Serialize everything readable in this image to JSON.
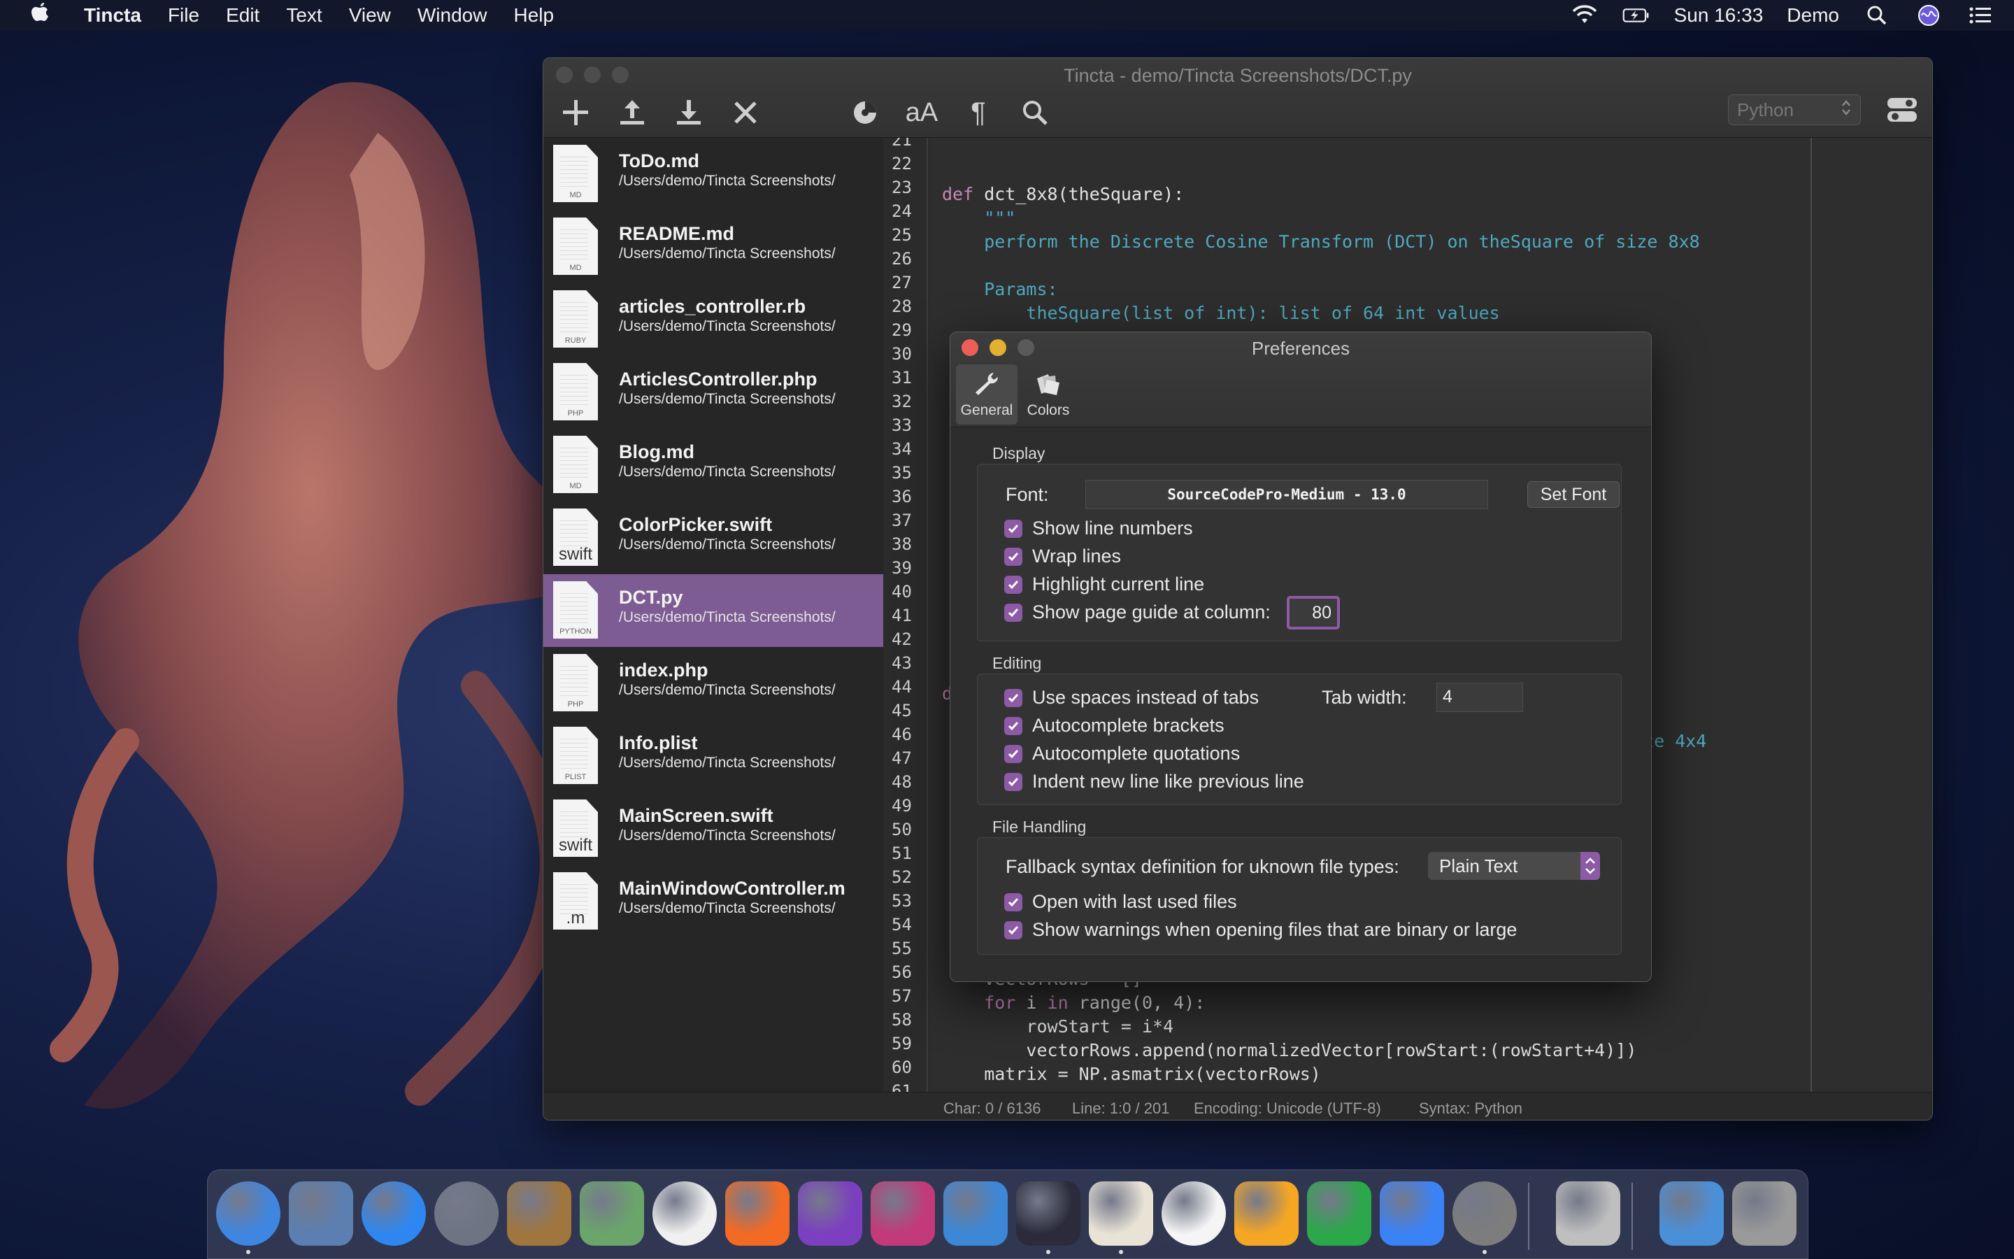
{
  "menubar": {
    "app_name": "Tincta",
    "items": [
      "File",
      "Edit",
      "Text",
      "View",
      "Window",
      "Help"
    ],
    "clock": "Sun 16:33",
    "user": "Demo",
    "icons": [
      "apple-icon",
      "wifi-icon",
      "battery-icon",
      "search-icon",
      "siri-icon",
      "notification-center-icon"
    ]
  },
  "window": {
    "title": "Tincta - demo/Tincta Screenshots/DCT.py",
    "toolbar_icons": [
      "new-icon",
      "upload-icon",
      "download-icon",
      "close-file-icon",
      "color-wheel-icon",
      "font-size-icon",
      "pilcrow-icon",
      "search-icon"
    ],
    "font_size_label": "aA",
    "pilcrow_label": "¶",
    "syntax_select": "Python"
  },
  "sidebar": {
    "files": [
      {
        "name": "ToDo.md",
        "path": "/Users/demo/Tincta Screenshots/",
        "ext": "MD",
        "selected": false
      },
      {
        "name": "README.md",
        "path": "/Users/demo/Tincta Screenshots/",
        "ext": "MD",
        "selected": false
      },
      {
        "name": "articles_controller.rb",
        "path": "/Users/demo/Tincta Screenshots/",
        "ext": "RUBY",
        "selected": false
      },
      {
        "name": "ArticlesController.php",
        "path": "/Users/demo/Tincta Screenshots/",
        "ext": "PHP",
        "selected": false
      },
      {
        "name": "Blog.md",
        "path": "/Users/demo/Tincta Screenshots/",
        "ext": "MD",
        "selected": false
      },
      {
        "name": "ColorPicker.swift",
        "path": "/Users/demo/Tincta Screenshots/",
        "ext": "swift",
        "selected": false
      },
      {
        "name": "DCT.py",
        "path": "/Users/demo/Tincta Screenshots/",
        "ext": "PYTHON",
        "selected": true
      },
      {
        "name": "index.php",
        "path": "/Users/demo/Tincta Screenshots/",
        "ext": "PHP",
        "selected": false
      },
      {
        "name": "Info.plist",
        "path": "/Users/demo/Tincta Screenshots/",
        "ext": "PLIST",
        "selected": false
      },
      {
        "name": "MainScreen.swift",
        "path": "/Users/demo/Tincta Screenshots/",
        "ext": "swift",
        "selected": false
      },
      {
        "name": "MainWindowController.m",
        "path": "/Users/demo/Tincta Screenshots/",
        "ext": ".m",
        "selected": false
      }
    ]
  },
  "editor": {
    "line_numbers": [
      "21",
      "22",
      "23",
      "24",
      "25",
      "26",
      "27",
      "28",
      "29",
      "30",
      "31",
      "32",
      "33",
      "34",
      "35",
      "36",
      "37",
      "38",
      "39",
      "40",
      "41",
      "42",
      "43",
      "44",
      "45",
      "46",
      "47",
      "48",
      "49",
      "50",
      "51",
      "52",
      "53",
      "54",
      "55",
      "56",
      "57",
      "58",
      "59",
      "60",
      "61"
    ],
    "visible_code": {
      "l23_kw": "def",
      "l23_rest": " dct_8x8(theSquare):",
      "l24": "    \"\"\"",
      "l25": "    perform the Discrete Cosine Transform (DCT) on theSquare of size 8x8",
      "l27": "    Params:",
      "l28": "        theSquare(list of int): list of 64 int values",
      "l38_frag": ")",
      "l45_frag": "d",
      "l47_frag": "ize 4x4",
      "l57": "    vectorRows = []",
      "l58_kw1": "    for",
      "l58_mid": " i ",
      "l58_kw2": "in",
      "l58_rest": " range(0, 4):",
      "l59": "        rowStart = i*4",
      "l60": "        vectorRows.append(normalizedVector[rowStart:(rowStart+4)])",
      "l61": "    matrix = NP.asmatrix(vectorRows)"
    }
  },
  "statusbar": {
    "char": "Char: 0 / 6136",
    "line": "Line: 1:0 / 201",
    "encoding": "Encoding: Unicode (UTF-8)",
    "syntax": "Syntax: Python"
  },
  "preferences": {
    "title": "Preferences",
    "tabs": [
      {
        "label": "General",
        "icon": "wrench-icon",
        "active": true
      },
      {
        "label": "Colors",
        "icon": "color-swatches-icon",
        "active": false
      }
    ],
    "display": {
      "label": "Display",
      "font_label": "Font:",
      "font_value": "SourceCodePro-Medium - 13.0",
      "set_font_button": "Set Font",
      "show_line_numbers": "Show line numbers",
      "wrap_lines": "Wrap lines",
      "highlight_current_line": "Highlight current line",
      "show_page_guide": "Show page guide at column:",
      "page_guide_column": "80"
    },
    "editing": {
      "label": "Editing",
      "use_spaces": "Use spaces instead of tabs",
      "tab_width_label": "Tab width:",
      "tab_width": "4",
      "autocomplete_brackets": "Autocomplete brackets",
      "autocomplete_quotations": "Autocomplete quotations",
      "indent_new_line": "Indent new line like previous line"
    },
    "file_handling": {
      "label": "File Handling",
      "fallback_label": "Fallback syntax definition for uknown file types:",
      "fallback_value": "Plain Text",
      "open_last_used": "Open with last used files",
      "show_warnings": "Show warnings when opening files that are binary or large"
    }
  },
  "dock": {
    "apps": [
      "finder-icon",
      "mail-icon",
      "app-store-icon",
      "launchpad-icon",
      "contacts-icon",
      "maps-icon",
      "photos-icon",
      "firefox-icon",
      "affinity-icon",
      "tincta-icon",
      "xcode-icon",
      "octopus-app-icon",
      "pixelmator-icon",
      "music-icon",
      "pages-icon",
      "numbers-icon",
      "keynote-icon",
      "system-preferences-icon",
      "font-book-icon",
      "folder-icon",
      "trash-icon"
    ],
    "colors": {
      "accent": "#8d5aa6",
      "selection": "#7d5c93"
    }
  }
}
